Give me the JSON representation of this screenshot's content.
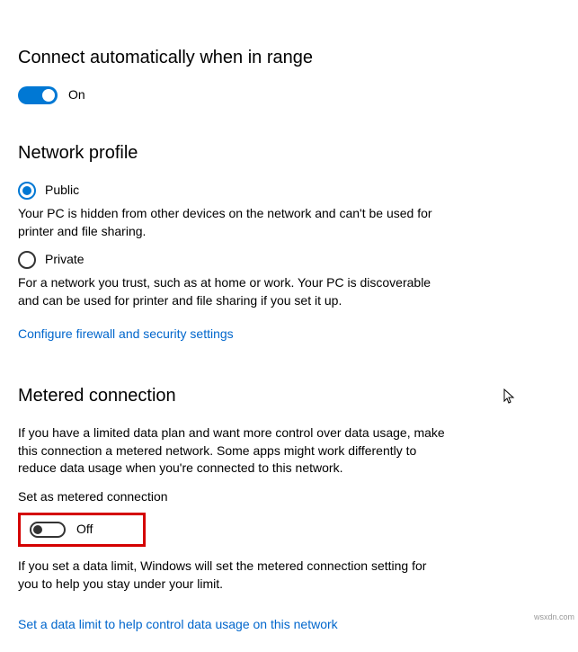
{
  "sections": {
    "connect_auto": {
      "title": "Connect automatically when in range",
      "toggle_state": "On"
    },
    "network_profile": {
      "title": "Network profile",
      "public": {
        "label": "Public",
        "description": "Your PC is hidden from other devices on the network and can't be used for printer and file sharing."
      },
      "private": {
        "label": "Private",
        "description": "For a network you trust, such as at home or work. Your PC is discoverable and can be used for printer and file sharing if you set it up."
      },
      "firewall_link": "Configure firewall and security settings"
    },
    "metered": {
      "title": "Metered connection",
      "description": "If you have a limited data plan and want more control over data usage, make this connection a metered network. Some apps might work differently to reduce data usage when you're connected to this network.",
      "sub_label": "Set as metered connection",
      "toggle_state": "Off",
      "limit_description": "If you set a data limit, Windows will set the metered connection setting for you to help you stay under your limit.",
      "data_limit_link": "Set a data limit to help control data usage on this network"
    }
  },
  "watermark": "wsxdn.com"
}
